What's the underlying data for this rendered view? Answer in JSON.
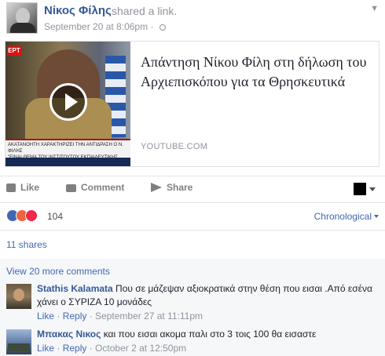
{
  "post": {
    "author": "Νίκος Φίλης",
    "action_text": "shared a link.",
    "timestamp": "September 20 at 8:06pm",
    "separator": "·"
  },
  "link": {
    "title": "Απάντηση Νίκου Φίλη στη δήλωση του Αρχιεπισκόπου για τα Θρησκευτικά",
    "domain": "YOUTUBE.COM",
    "ticker_line1": "ΑΚΑΤΑΝΟΗΤΗ ΧΑΡΑΚΤΗΡΙΖΕΙ ΤΗΝ ΑΝΤΙΔΡΑΣΗ Ο Ν. ΦΙΛΗΣ",
    "ticker_line2": "\"ΕΙΝΑΙ ΘΕΜΑ ΤΟΥ ΙΝΣΤΙΤΟΥΤΟΥ ΕΚΠΑΙΔΕΥΤΙΚΗΣ ΠΟΛΙΤΙΚΗΣ\"",
    "channel_logo": "ΕΡΤ"
  },
  "actions": {
    "like": "Like",
    "comment": "Comment",
    "share": "Share"
  },
  "reactions": {
    "count": "104",
    "icons": [
      "like-icon",
      "angry-icon",
      "love-icon"
    ],
    "colors": {
      "like": "#4267b2",
      "angry": "#f0643c",
      "love": "#f0284a"
    }
  },
  "sort": {
    "label": "Chronological"
  },
  "shares": {
    "label": "11 shares"
  },
  "comments": {
    "view_more": "View 20 more comments",
    "items": [
      {
        "name": "Stathis Kalamata",
        "text": "Που σε μάζεψαν αξιοκρατικά στην θέση που εισαι .Από εσένα χάνει ο ΣΥΡΙΖΑ 10 μονάδες",
        "like": "Like",
        "reply": "Reply",
        "time": "September 27 at 11:11pm"
      },
      {
        "name": "Μπακας Νικος",
        "text": "και που εισαι ακομα παλι στο 3 τοις 100 θα εισαστε",
        "like": "Like",
        "reply": "Reply",
        "time": "October 2 at 12:50pm"
      }
    ]
  },
  "theme": {
    "link_blue": "#365899",
    "accent_blue": "#4267b2",
    "meta_gray": "#90949c"
  }
}
